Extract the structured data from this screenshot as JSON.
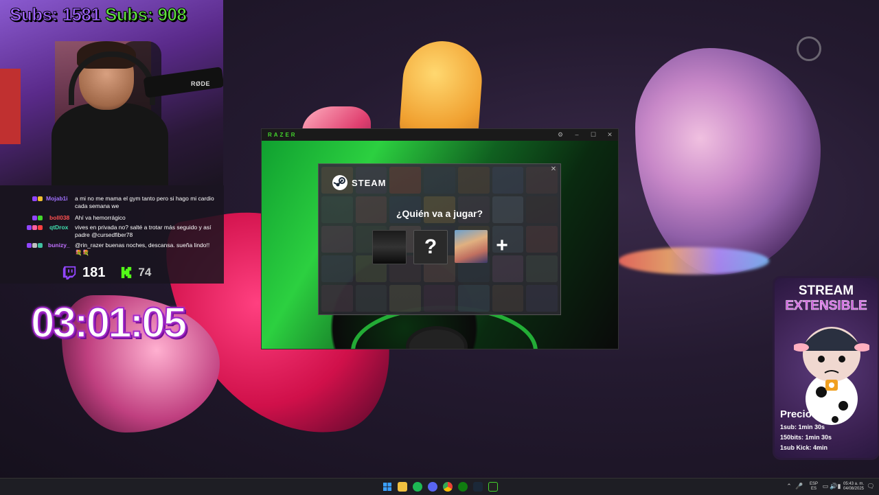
{
  "overlay": {
    "subs_twitch": "Subs: 1581",
    "subs_kick": "Subs: 908",
    "mic_brand": "RØDE",
    "viewers_twitch": "181",
    "viewers_kick": "74",
    "timer": "03:01:05"
  },
  "chat": {
    "messages": [
      {
        "user": "Mojab1i",
        "user_color": "#a070ff",
        "text": "a mi no me mama el gym tanto pero si hago mi cardio cada semana we"
      },
      {
        "user": "boll038",
        "user_color": "#ff5050",
        "text": "Ahí va hemorrágico"
      },
      {
        "user": "qtDrox",
        "user_color": "#40e0b0",
        "text": "vives en privada no? salté a trotar más seguido y así padre @cursedfiber78"
      },
      {
        "user": "bunizy_",
        "user_color": "#c070ff",
        "text": "@rin_razer buenas noches, descansa. sueña lindo!! 💐💐"
      }
    ]
  },
  "razer_window": {
    "logo": "RAZER",
    "controls": [
      "⚙",
      "–",
      "☐",
      "✕"
    ]
  },
  "steam_dialog": {
    "brand": "STEAM",
    "question": "¿Quién va a jugar?",
    "unknown_profile": "?",
    "add_label": "+",
    "close": "✕"
  },
  "extensible": {
    "title1": "STREAM",
    "title2": "EXTENSIBLE",
    "precios": "Precios",
    "lines": [
      "1sub: 1min 30s",
      "150bits: 1min 30s",
      "1sub Kick: 4min"
    ]
  },
  "taskbar": {
    "icons": [
      "windows-start-icon",
      "file-explorer-icon",
      "spotify-icon",
      "discord-icon",
      "chrome-icon",
      "xbox-icon",
      "steam-icon",
      "razer-icon"
    ],
    "lang_top": "ESP",
    "lang_bottom": "ES",
    "time": "05:43 a. m.",
    "date": "04/08/2025"
  },
  "colors": {
    "razer_green": "#44d62c",
    "twitch_purple": "#9146ff",
    "kick_green": "#53fc18"
  }
}
